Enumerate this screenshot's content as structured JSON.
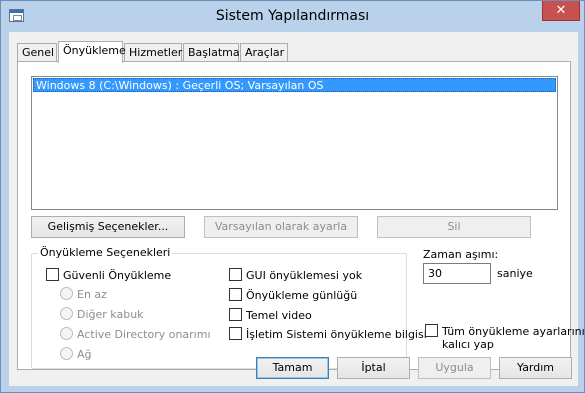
{
  "window": {
    "title": "Sistem Yapılandırması",
    "close_glyph": "✕"
  },
  "tabs": [
    {
      "label": "Genel",
      "active": false
    },
    {
      "label": "Önyükleme",
      "active": true
    },
    {
      "label": "Hizmetler",
      "active": false
    },
    {
      "label": "Başlatma",
      "active": false
    },
    {
      "label": "Araçlar",
      "active": false
    }
  ],
  "boot_list": {
    "entries": [
      "Windows 8 (C:\\Windows) : Geçerli OS; Varsayılan OS"
    ]
  },
  "boot_buttons": {
    "advanced": "Gelişmiş Seçenekler...",
    "set_default": "Varsayılan olarak ayarla",
    "delete": "Sil"
  },
  "boot_options": {
    "title": "Önyükleme Seçenekleri",
    "safe_boot": "Güvenli Önyükleme",
    "minimal": "En az",
    "alternate_shell": "Diğer kabuk",
    "ad_repair": "Active Directory onarımı",
    "network": "Ağ",
    "no_gui_boot": "GUI önyüklemesi yok",
    "boot_log": "Önyükleme günlüğü",
    "base_video": "Temel video",
    "os_boot_info": "İşletim Sistemi önyükleme bilgisi"
  },
  "timeout": {
    "label": "Zaman aşımı:",
    "value": "30",
    "unit": "saniye"
  },
  "make_permanent": {
    "line1": "Tüm önyükleme ayarlarını",
    "line2": "kalıcı yap"
  },
  "footer": {
    "ok": "Tamam",
    "cancel": "İptal",
    "apply": "Uygula",
    "help": "Yardım"
  },
  "colors": {
    "selection": "#3399ff",
    "close_button": "#c75050",
    "title_bar": "#b9d1ea"
  }
}
